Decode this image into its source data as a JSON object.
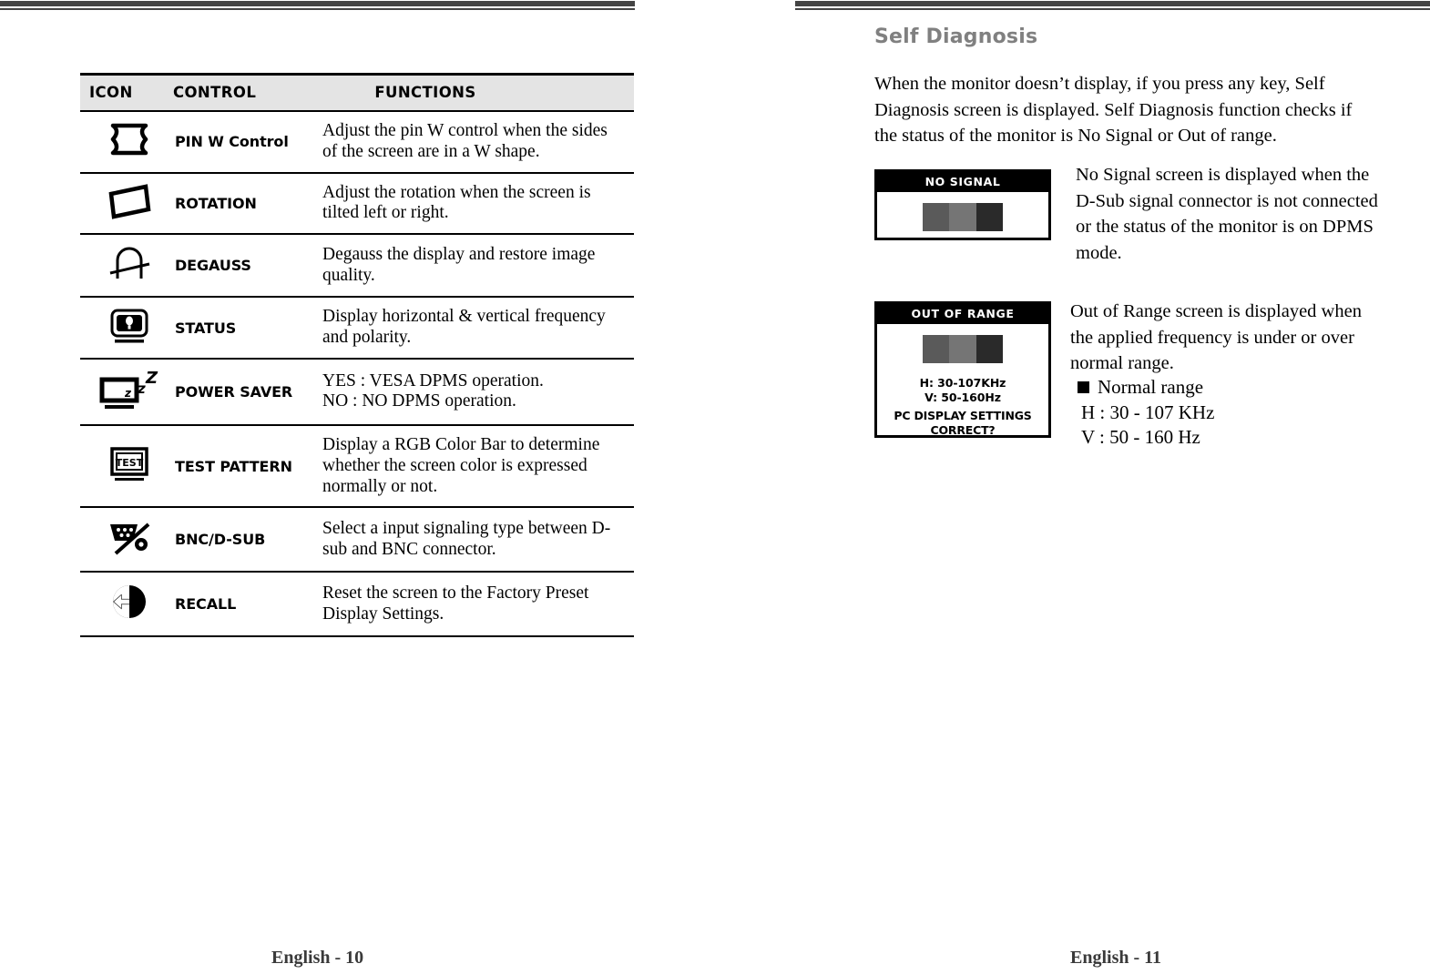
{
  "pages": {
    "left": {
      "footer": "English - 10",
      "table": {
        "headers": {
          "icon": "ICON",
          "control": "CONTROL",
          "functions": "FUNCTIONS"
        },
        "rows": [
          {
            "icon_name": "pin-w-control-icon",
            "control": "PIN W Control",
            "function_lines": [
              "Adjust the pin W control when the sides",
              "of the screen are in a W shape."
            ]
          },
          {
            "icon_name": "rotation-icon",
            "control": "ROTATION",
            "function_lines": [
              "Adjust the rotation when the screen is",
              "tilted left or right."
            ]
          },
          {
            "icon_name": "degauss-magnet-icon",
            "control": "DEGAUSS",
            "function_lines": [
              "Degauss the display and restore image",
              "quality."
            ]
          },
          {
            "icon_name": "status-monitor-icon",
            "control": "STATUS",
            "function_lines": [
              "Display horizontal & vertical frequency",
              "and polarity."
            ]
          },
          {
            "icon_name": "power-saver-sleep-icon",
            "control": "POWER SAVER",
            "function_lines": [
              "YES : VESA DPMS operation.",
              "NO : NO DPMS operation."
            ]
          },
          {
            "icon_name": "test-pattern-icon",
            "control": "TEST PATTERN",
            "function_lines": [
              "Display a RGB Color Bar to determine",
              "whether the screen color is expressed",
              "normally or not."
            ]
          },
          {
            "icon_name": "bnc-dsub-connector-icon",
            "control": "BNC/D-SUB",
            "function_lines": [
              "Select a input signaling type between D-",
              "sub and BNC connector."
            ]
          },
          {
            "icon_name": "recall-arrows-icon",
            "control": "RECALL",
            "function_lines": [
              "Reset the screen to the Factory Preset",
              "Display Settings."
            ]
          }
        ]
      }
    },
    "right": {
      "footer": "English - 11",
      "title": "Self Diagnosis",
      "intro_lines": [
        "When the monitor doesn’t  display, if you press any key, Self",
        "Diagnosis screen is displayed.  Self Diagnosis function checks if",
        "the status of the monitor is No Signal or Out of range."
      ],
      "no_signal": {
        "osd_title": "NO SIGNAL",
        "description_lines": [
          "No Signal screen is displayed when the",
          "D-Sub signal connector is not connected",
          "or the status of the monitor is on DPMS",
          "mode."
        ]
      },
      "out_of_range": {
        "osd_title": "OUT OF RANGE",
        "osd_freq_h": "H: 30-107KHz",
        "osd_freq_v": "V: 50-160Hz",
        "osd_ask_line1": "PC DISPLAY SETTINGS",
        "osd_ask_line2": "CORRECT?",
        "description_lines": [
          "Out of Range screen is displayed when",
          "the applied frequency is under or over",
          "normal range."
        ],
        "normal_range_label": "Normal range",
        "normal_range_h": "H : 30 - 107 KHz",
        "normal_range_v": "V : 50 - 160 Hz"
      }
    }
  },
  "colors": {
    "rule": "#444444",
    "header_bg": "#e4e4e4",
    "heading_gray": "#808080",
    "bar_dark_gray": "#5a5a5a",
    "bar_mid_gray": "#757575",
    "bar_near_black": "#2a2a2a"
  }
}
